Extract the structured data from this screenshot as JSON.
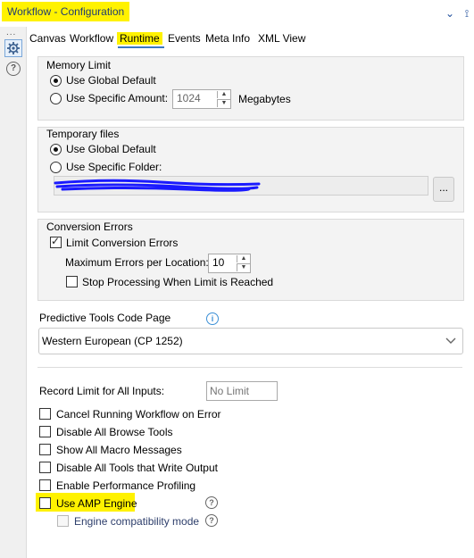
{
  "window": {
    "title": "Workflow - Configuration",
    "collapse_glyph": "⌄",
    "pin_glyph": "⟟"
  },
  "rail": {
    "dots": "...",
    "help": "?"
  },
  "tabs": [
    {
      "label": "Canvas"
    },
    {
      "label": "Workflow"
    },
    {
      "label": "Runtime"
    },
    {
      "label": "Events"
    },
    {
      "label": "Meta Info"
    },
    {
      "label": "XML View"
    }
  ],
  "memory_limit": {
    "label": "Memory Limit",
    "option_global": "Use Global Default",
    "option_specific": "Use Specific Amount:",
    "amount": "1024",
    "unit": "Megabytes"
  },
  "temporary_files": {
    "label": "Temporary files",
    "option_global": "Use Global Default",
    "option_specific": "Use Specific Folder:",
    "folder_path": "",
    "browse_label": "..."
  },
  "conversion_errors": {
    "label": "Conversion Errors",
    "limit_label": "Limit Conversion Errors",
    "max_label": "Maximum Errors per Location:",
    "max_value": "10",
    "stop_label": "Stop Processing When Limit is Reached"
  },
  "predictive": {
    "label": "Predictive Tools Code Page",
    "selected": "Western European (CP 1252)",
    "info": "i"
  },
  "record_limit": {
    "label": "Record Limit for All Inputs:",
    "placeholder": "No Limit"
  },
  "options": {
    "cancel_on_error": "Cancel Running Workflow on Error",
    "disable_browse": "Disable All Browse Tools",
    "show_macro": "Show All Macro Messages",
    "disable_output": "Disable All Tools that Write Output",
    "perf_profiling": "Enable Performance Profiling",
    "amp_engine": "Use AMP Engine",
    "engine_compat": "Engine compatibility mode",
    "help": "?"
  },
  "colors": {
    "highlight": "#fff200",
    "accent": "#3b78c4",
    "link_blue": "#1f4e9b",
    "scribble": "#1a1aff",
    "info_blue": "#3b8fd6"
  }
}
